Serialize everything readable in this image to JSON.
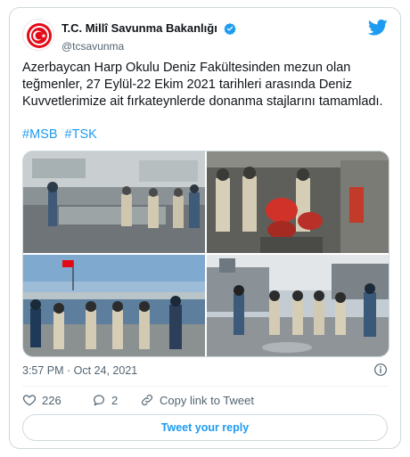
{
  "author": {
    "display_name": "T.C. Millî Savunma Bakanlığı",
    "handle": "@tcsavunma",
    "verified": true,
    "avatar_icon": "ministry-emblem-icon"
  },
  "tweet": {
    "text": "Azerbaycan Harp Okulu Deniz Fakültesinden mezun olan teğmenler, 27 Eylül-22 Ekim 2021 tarihleri arasında Deniz Kuvvetlerimize ait fırkateynlerde donanma stajlarını tamamladı.",
    "hashtags": [
      "#MSB",
      "#TSK"
    ],
    "timestamp": "3:57 PM · Oct 24, 2021"
  },
  "media": {
    "photos": [
      "ship-bridge-photo",
      "engine-room-photo",
      "harbor-deck-photo",
      "frigate-deck-photo"
    ]
  },
  "actions": {
    "like_count": "226",
    "reply_count": "2",
    "copy_link_label": "Copy link to Tweet"
  },
  "reply_button_label": "Tweet your reply",
  "colors": {
    "accent": "#1d9bf0",
    "text": "#0f1419",
    "secondary": "#536471",
    "border": "#cfd9de",
    "emblem_red": "#e30a17"
  }
}
